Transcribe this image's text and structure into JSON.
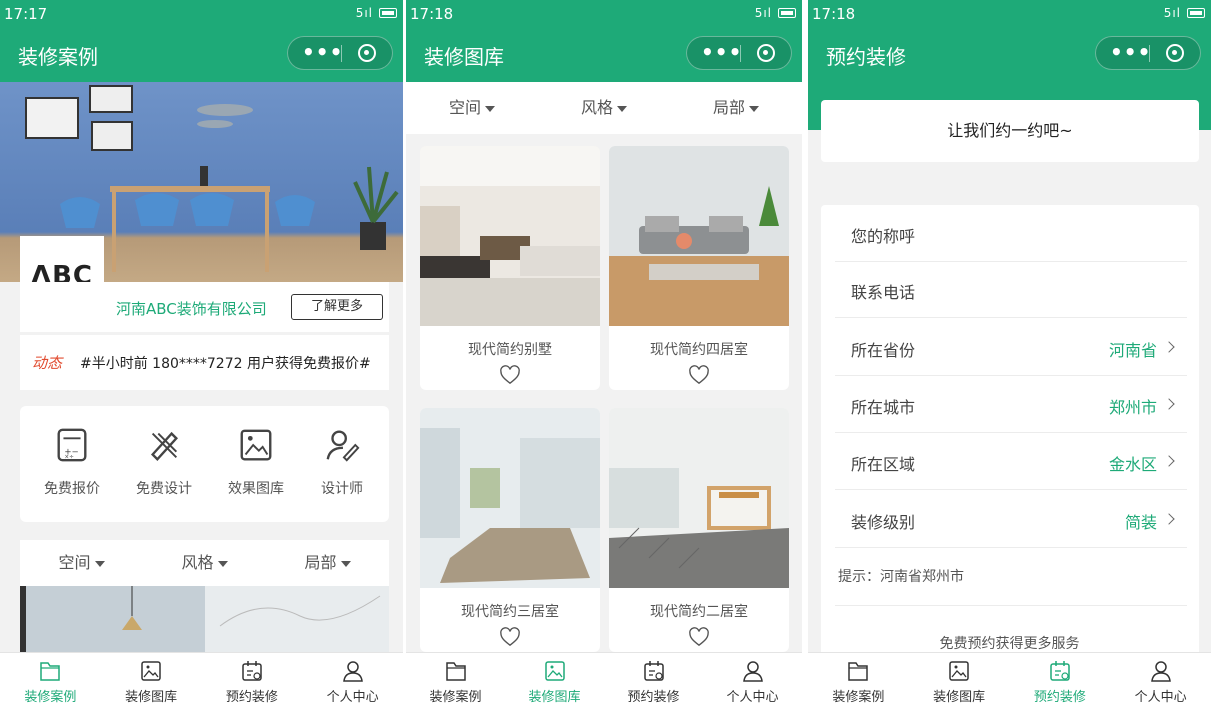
{
  "phones": [
    {
      "time": "17:17",
      "title": "装修案例"
    },
    {
      "time": "17:18",
      "title": "装修图库"
    },
    {
      "time": "17:18",
      "title": "预约装修"
    }
  ],
  "status": {
    "signal": "5ıl"
  },
  "capsule": {
    "dots": "•••"
  },
  "tabs": [
    "装修案例",
    "装修图库",
    "预约装修",
    "个人中心"
  ],
  "case": {
    "logo": "ΛBC",
    "company": "河南ABC装饰有限公司",
    "more": "了解更多",
    "news_tag": "动态",
    "news_text": "#半小时前 180****7272 用户获得免费报价#",
    "quick": [
      "免费报价",
      "免费设计",
      "效果图库",
      "设计师"
    ]
  },
  "filters": [
    "空间",
    "风格",
    "局部"
  ],
  "gallery": [
    "现代简约别墅",
    "现代简约四居室",
    "现代简约三居室",
    "现代简约二居室"
  ],
  "booking": {
    "header": "让我们约一约吧~",
    "fields": [
      {
        "label": "您的称呼",
        "value": ""
      },
      {
        "label": "联系电话",
        "value": ""
      },
      {
        "label": "所在省份",
        "value": "河南省"
      },
      {
        "label": "所在城市",
        "value": "郑州市"
      },
      {
        "label": "所在区域",
        "value": "金水区"
      },
      {
        "label": "装修级别",
        "value": "简装"
      }
    ],
    "hint": "提示：河南省郑州市",
    "service": "免费预约获得更多服务"
  },
  "colors": {
    "brand": "#1eaa78",
    "accent_red": "#e14b2f"
  },
  "icons": [
    "folder-icon",
    "image-icon",
    "calendar-icon",
    "user-icon",
    "calculator-icon",
    "design-tools-icon",
    "gallery-icon",
    "designer-icon",
    "heart-icon"
  ]
}
